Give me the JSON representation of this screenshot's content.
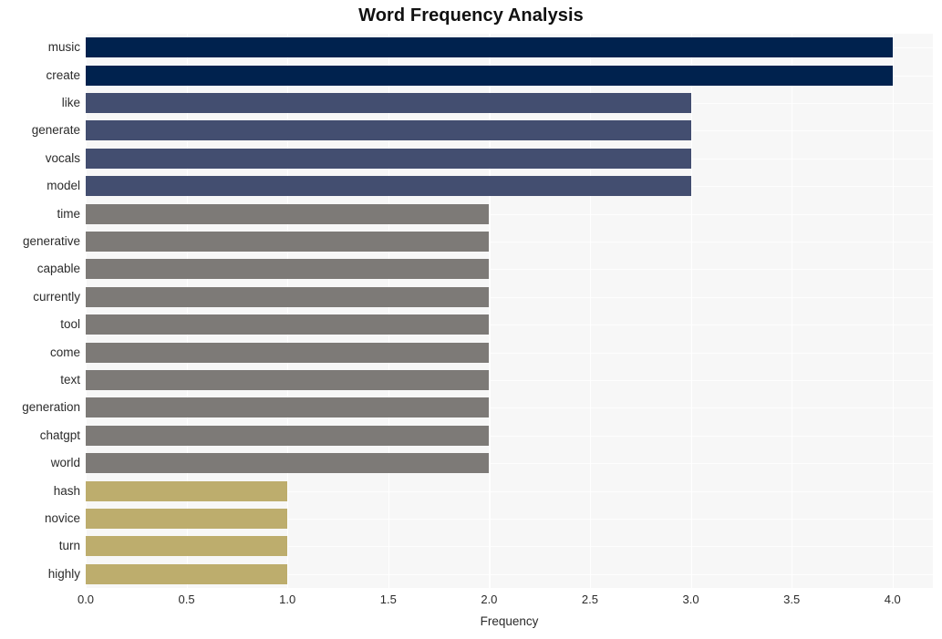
{
  "chart_data": {
    "type": "bar",
    "orientation": "horizontal",
    "title": "Word Frequency Analysis",
    "xlabel": "Frequency",
    "ylabel": "",
    "categories": [
      "music",
      "create",
      "like",
      "generate",
      "vocals",
      "model",
      "time",
      "generative",
      "capable",
      "currently",
      "tool",
      "come",
      "text",
      "generation",
      "chatgpt",
      "world",
      "hash",
      "novice",
      "turn",
      "highly"
    ],
    "values": [
      4,
      4,
      3,
      3,
      3,
      3,
      2,
      2,
      2,
      2,
      2,
      2,
      2,
      2,
      2,
      2,
      1,
      1,
      1,
      1
    ],
    "bar_colors": [
      "#00224e",
      "#00224e",
      "#434e70",
      "#434e70",
      "#434e70",
      "#434e70",
      "#7d7a77",
      "#7d7a77",
      "#7d7a77",
      "#7d7a77",
      "#7d7a77",
      "#7d7a77",
      "#7d7a77",
      "#7d7a77",
      "#7d7a77",
      "#7d7a77",
      "#bdad6d",
      "#bdad6d",
      "#bdad6d",
      "#bdad6d"
    ],
    "xlim": [
      0.0,
      4.2
    ],
    "xticks": [
      0.0,
      0.5,
      1.0,
      1.5,
      2.0,
      2.5,
      3.0,
      3.5,
      4.0
    ],
    "xtick_labels": [
      "0.0",
      "0.5",
      "1.0",
      "1.5",
      "2.0",
      "2.5",
      "3.0",
      "3.5",
      "4.0"
    ],
    "grid": true,
    "grid_color": "#ffffff",
    "plot_background": "#f7f7f7",
    "figure_background": "#ffffff",
    "legend": null
  }
}
